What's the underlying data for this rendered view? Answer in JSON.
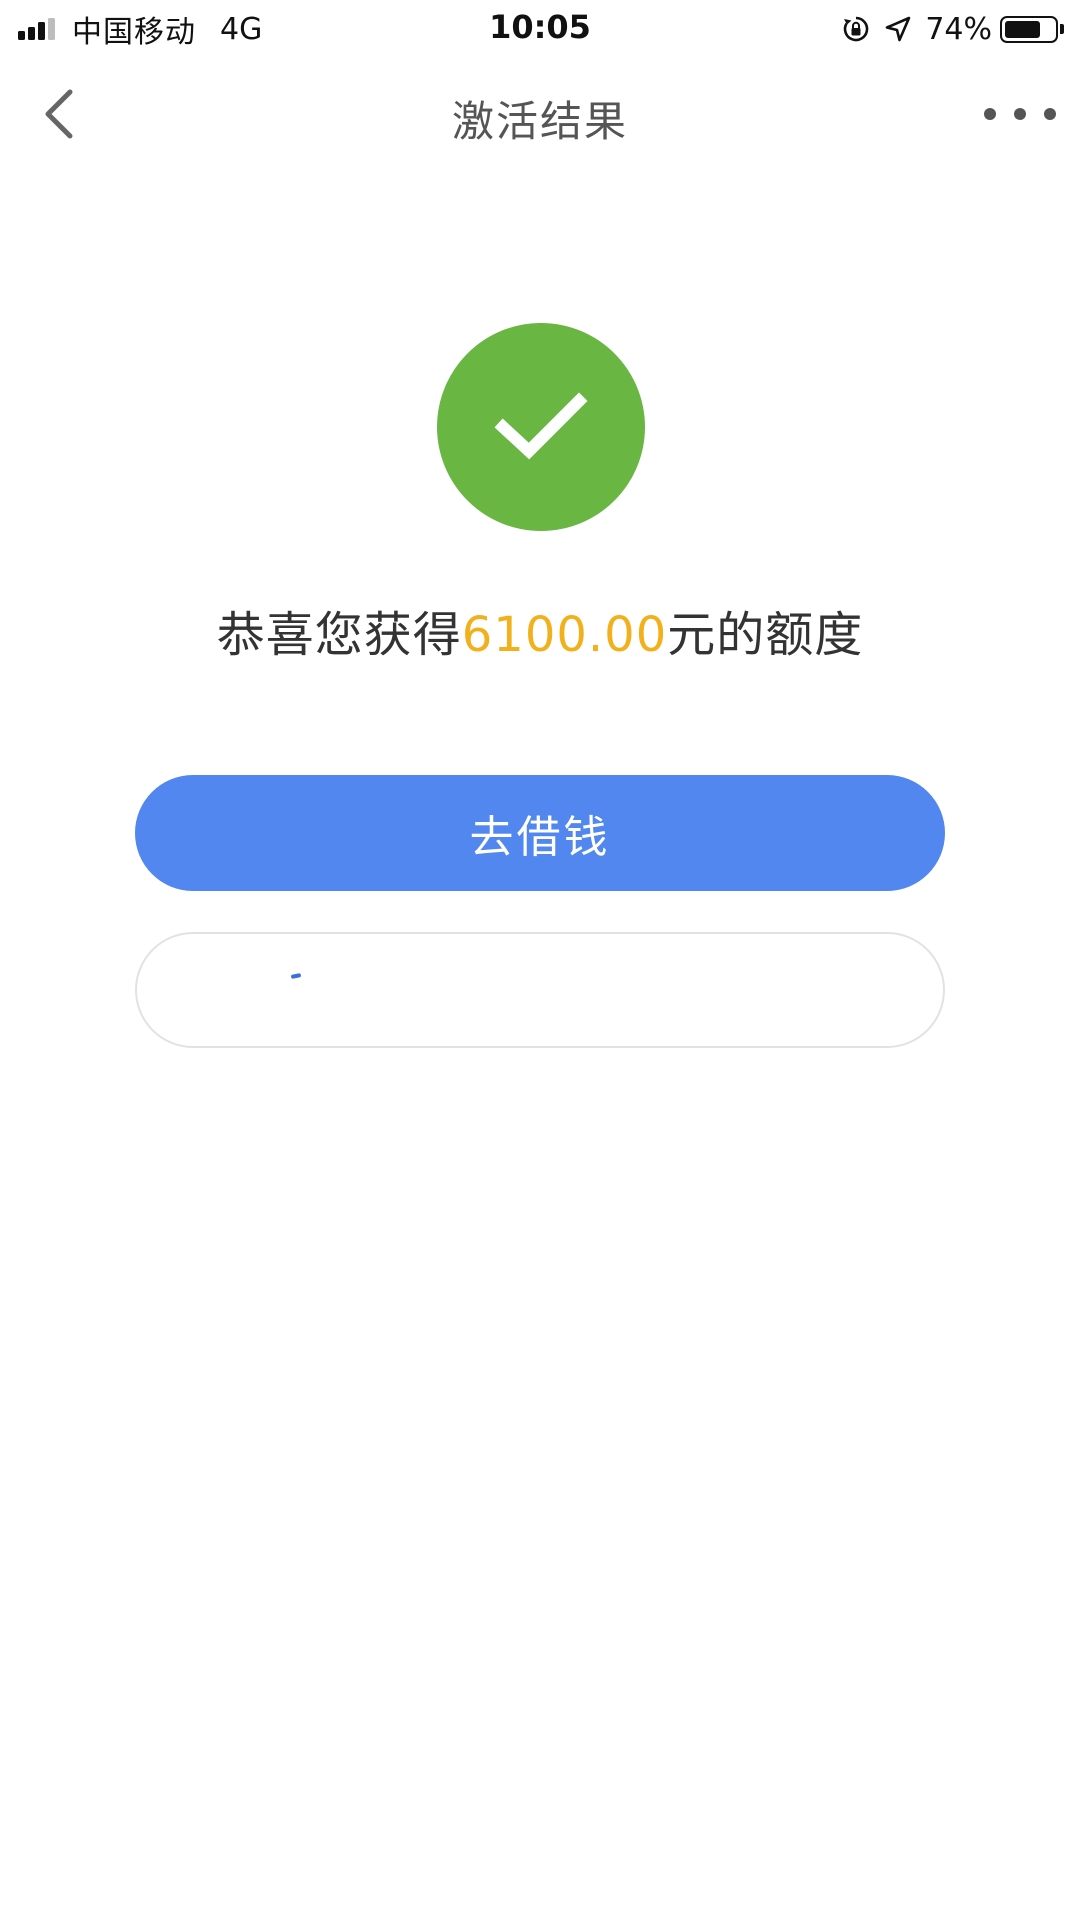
{
  "status_bar": {
    "carrier": "中国移动",
    "network": "4G",
    "time": "10:05",
    "battery_percent": "74%",
    "battery_level": 0.74
  },
  "nav": {
    "title": "激活结果",
    "back_icon": "chevron-left-icon",
    "more_icon": "more-dots-icon"
  },
  "result": {
    "icon": "check-circle-icon",
    "icon_color": "#6ab643",
    "message_prefix": "恭喜您获得",
    "amount": "6100.00",
    "message_suffix": "元的额度",
    "amount_color": "#f2b11c"
  },
  "actions": {
    "primary_label": "去借钱",
    "primary_color": "#5187ee",
    "secondary_label": ""
  }
}
